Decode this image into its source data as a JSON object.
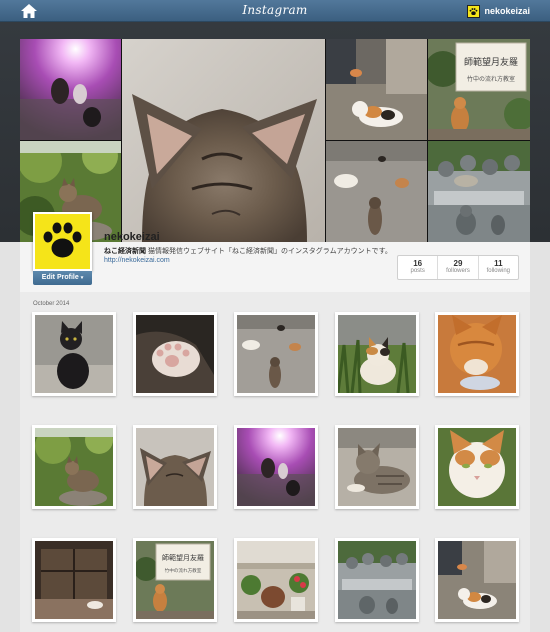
{
  "topbar": {
    "brand": "Instagram",
    "username": "nekokeizai",
    "home_icon": "home-icon",
    "avatar_icon": "paw-icon"
  },
  "profile": {
    "username": "nekokeizai",
    "bio_name": "ねこ経済新聞",
    "bio_text": "猫情報発信ウェブサイト「ねこ経済新聞」のインスタグラムアカウントです。",
    "website": "http://nekokeizai.com",
    "edit_label": "Edit Profile",
    "stats": [
      {
        "value": "16",
        "label": "posts"
      },
      {
        "value": "29",
        "label": "followers"
      },
      {
        "value": "11",
        "label": "following"
      }
    ]
  },
  "feed": {
    "month_label": "October 2014",
    "photos": [
      {
        "name": "black-cat-photo"
      },
      {
        "name": "cat-paw-photo"
      },
      {
        "name": "street-cats-photo"
      },
      {
        "name": "calico-in-grass-photo"
      },
      {
        "name": "orange-cat-eating-photo"
      },
      {
        "name": "tabby-on-rock-photo"
      },
      {
        "name": "cat-ears-closeup-photo"
      },
      {
        "name": "cats-at-sunset-photo"
      },
      {
        "name": "tabby-lying-photo"
      },
      {
        "name": "white-orange-cat-face-photo"
      },
      {
        "name": "window-cat-photo"
      },
      {
        "name": "shop-sign-cat-photo"
      },
      {
        "name": "flower-pots-photo"
      },
      {
        "name": "stone-statues-photo"
      },
      {
        "name": "calico-by-car-photo"
      }
    ]
  },
  "sign": {
    "line1": "師範望月友羅",
    "line2": "竹中の流れ方教室"
  },
  "colors": {
    "topbar": "#46698a",
    "header_band": "#32373c",
    "link": "#3a6a9a",
    "button": "#4a7599",
    "avatar_bg": "#f5e419"
  }
}
